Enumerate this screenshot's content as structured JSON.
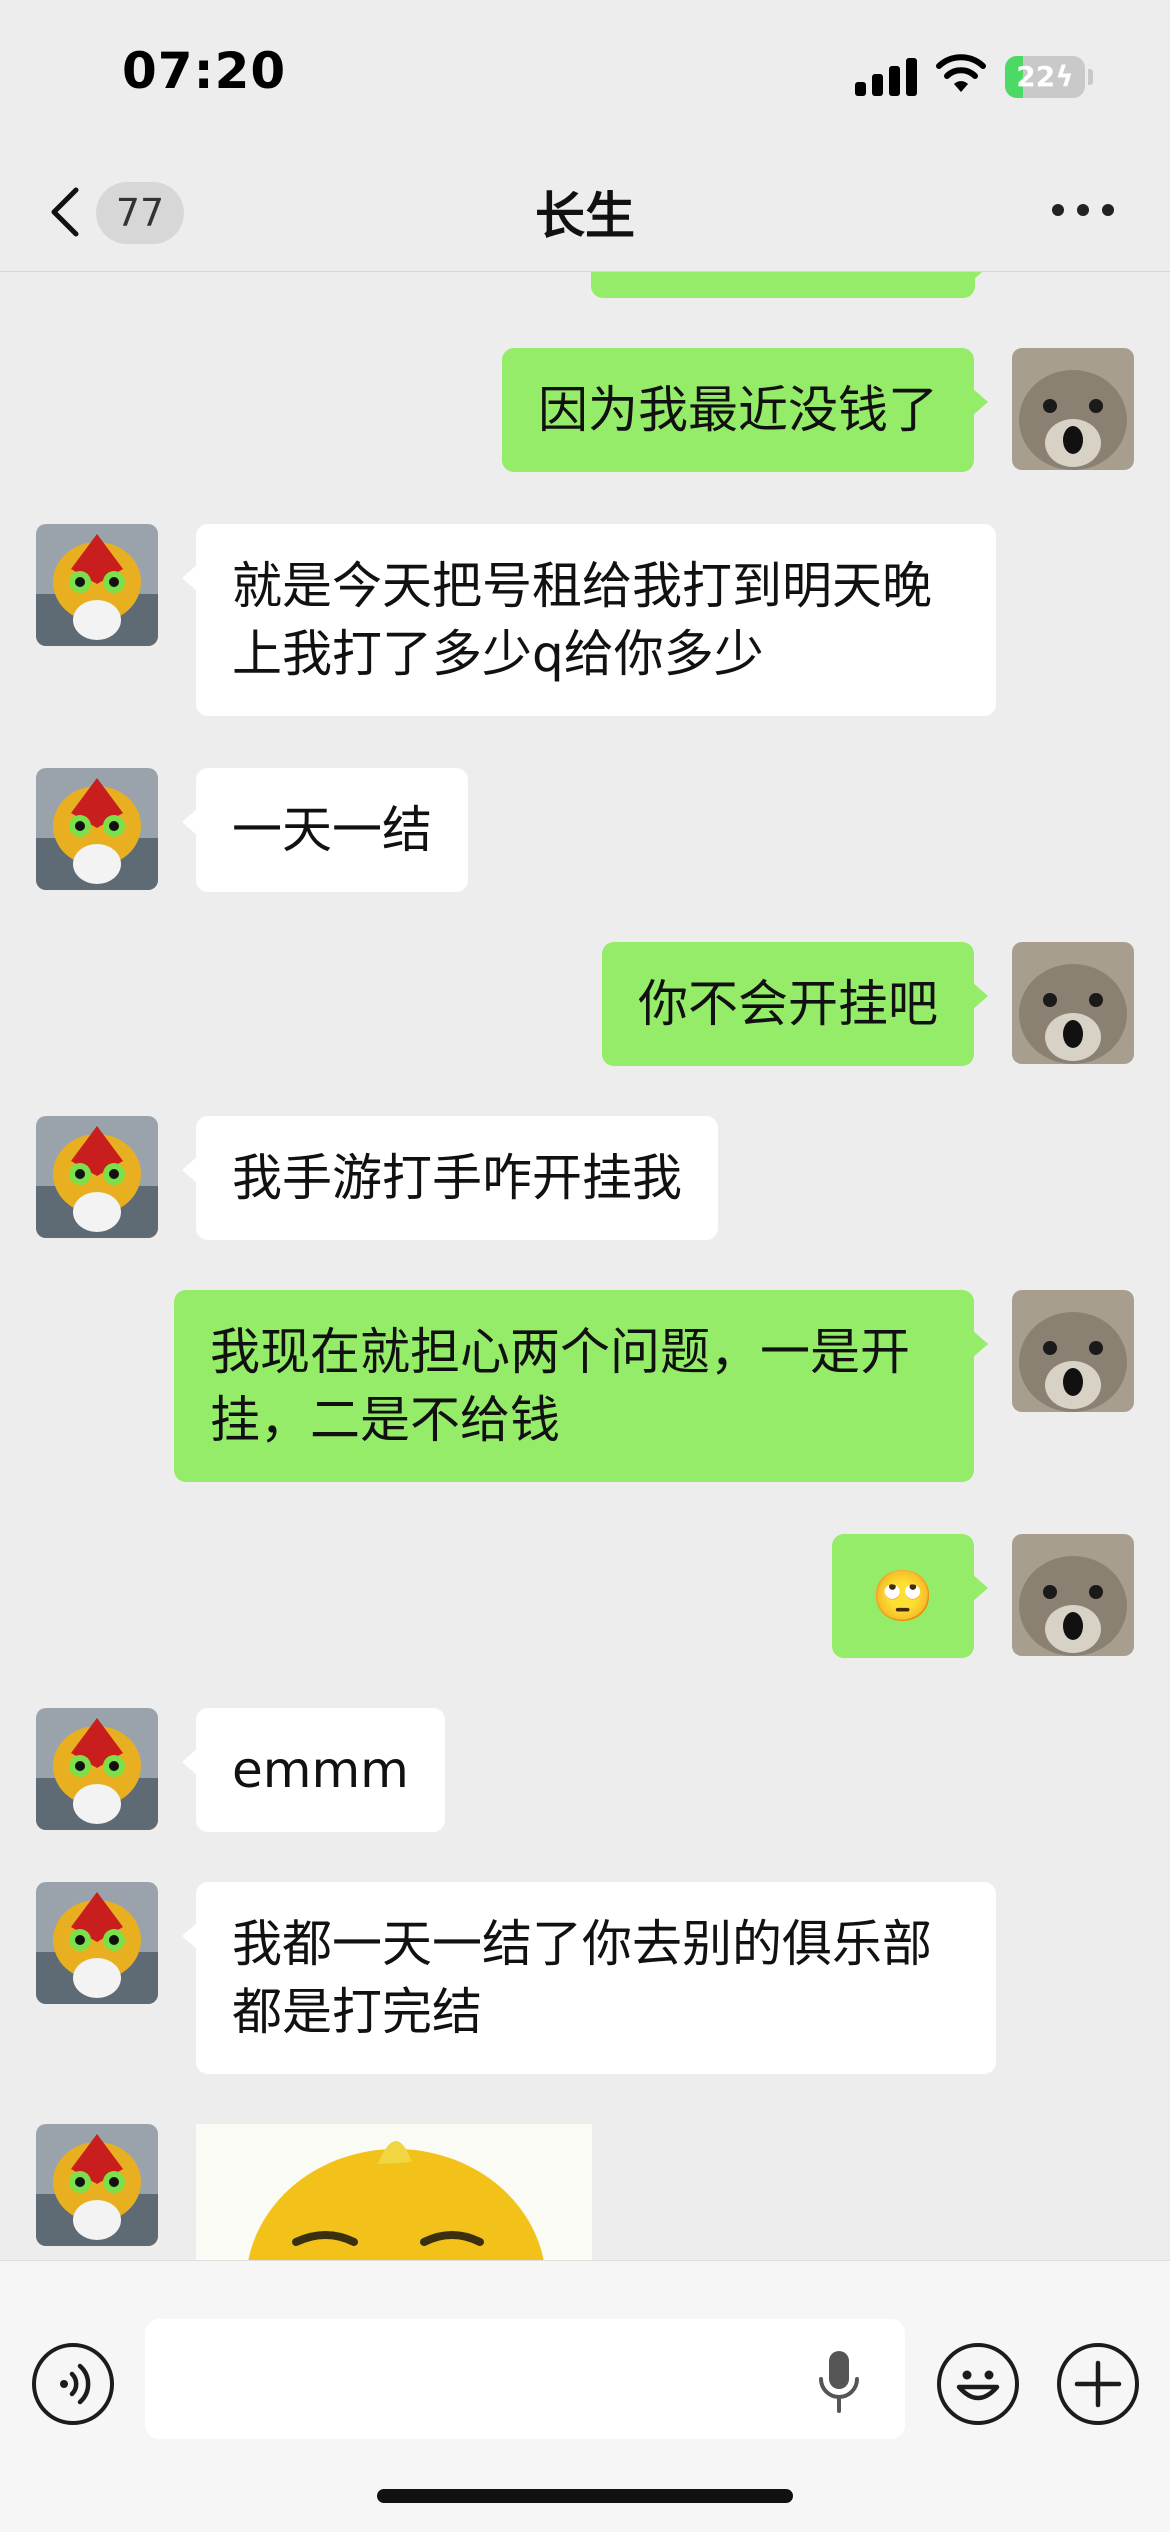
{
  "status_bar": {
    "time": "07:20",
    "battery": "22",
    "battery_level": 0.22,
    "charging": true
  },
  "nav": {
    "back_count": "77",
    "title": "长生",
    "more_icon": "more-dots-icon"
  },
  "contact_avatar_icon": "robot-cat-avatar",
  "self_avatar_icon": "hamster-avatar",
  "messages": [
    {
      "side": "out",
      "text": ""
    },
    {
      "side": "out",
      "text": "因为我最近没钱了"
    },
    {
      "side": "in",
      "text": "就是今天把号租给我打到明天晚上我打了多少q给你多少"
    },
    {
      "side": "in",
      "text": "一天一结"
    },
    {
      "side": "out",
      "text": "你不会开挂吧"
    },
    {
      "side": "in",
      "text": "我手游打手咋开挂我"
    },
    {
      "side": "out",
      "text": "我现在就担心两个问题，一是开挂，二是不给钱"
    },
    {
      "side": "out",
      "text": "🙄",
      "type": "emoji"
    },
    {
      "side": "in",
      "text": "emmm"
    },
    {
      "side": "in",
      "text": "我都一天一结了你去别的俱乐部都是打完结"
    },
    {
      "side": "in",
      "type": "sticker",
      "sticker": "bald-face-sticker"
    }
  ],
  "input_bar": {
    "voice_icon": "voice-mode-icon",
    "input_value": "",
    "mic_icon": "microphone-icon",
    "emoji_icon": "emoji-smile-icon",
    "plus_icon": "plus-icon"
  },
  "colors": {
    "outgoing_bubble": "#95ec69",
    "incoming_bubble": "#ffffff",
    "background": "#ededed"
  }
}
